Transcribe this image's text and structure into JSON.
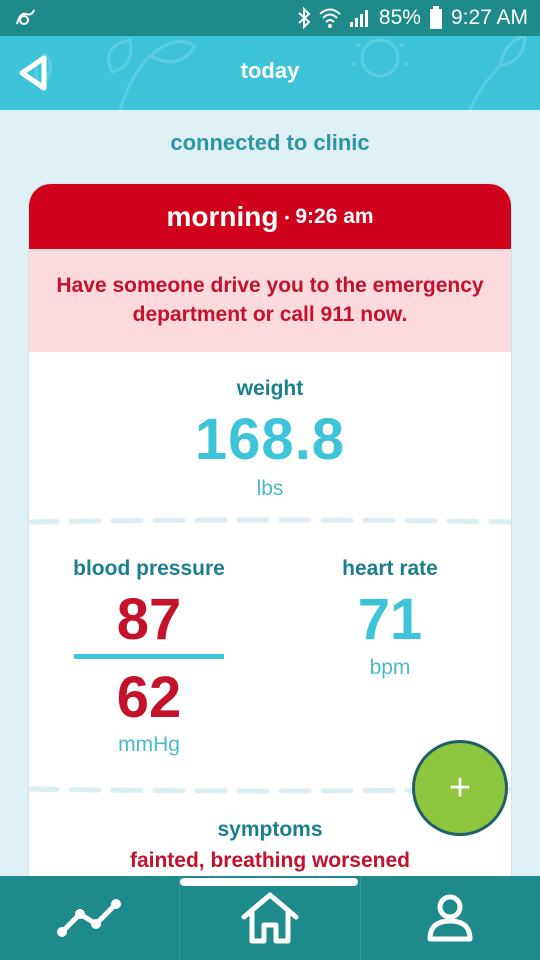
{
  "status_bar": {
    "battery": "85%",
    "time": "9:27 AM",
    "icons": [
      "app-notification-icon",
      "bluetooth-icon",
      "wifi-icon",
      "signal-icon",
      "battery-icon"
    ]
  },
  "header": {
    "title": "today",
    "back_icon": "back-arrow-icon"
  },
  "connection": {
    "status": "connected to clinic"
  },
  "reading": {
    "period": "morning",
    "separator": "•",
    "time": "9:26 am",
    "alert": "Have someone drive you to the emergency department or call 911 now.",
    "weight": {
      "label": "weight",
      "value": "168.8",
      "unit": "lbs"
    },
    "blood_pressure": {
      "label": "blood pressure",
      "systolic": "87",
      "diastolic": "62",
      "unit": "mmHg"
    },
    "heart_rate": {
      "label": "heart rate",
      "value": "71",
      "unit": "bpm"
    },
    "symptoms": {
      "label": "symptoms",
      "value": "fainted, breathing worsened"
    }
  },
  "fab": {
    "label": "+",
    "icon": "plus-icon"
  },
  "bottom_nav": {
    "items": [
      {
        "icon": "trends-icon"
      },
      {
        "icon": "home-icon",
        "active": true
      },
      {
        "icon": "profile-icon"
      }
    ]
  },
  "colors": {
    "status_bar": "#1e8a8c",
    "header": "#3ec4d8",
    "alert_red": "#d0021b",
    "alert_bg": "#fbd9dd",
    "fab_green": "#8dc63f"
  }
}
